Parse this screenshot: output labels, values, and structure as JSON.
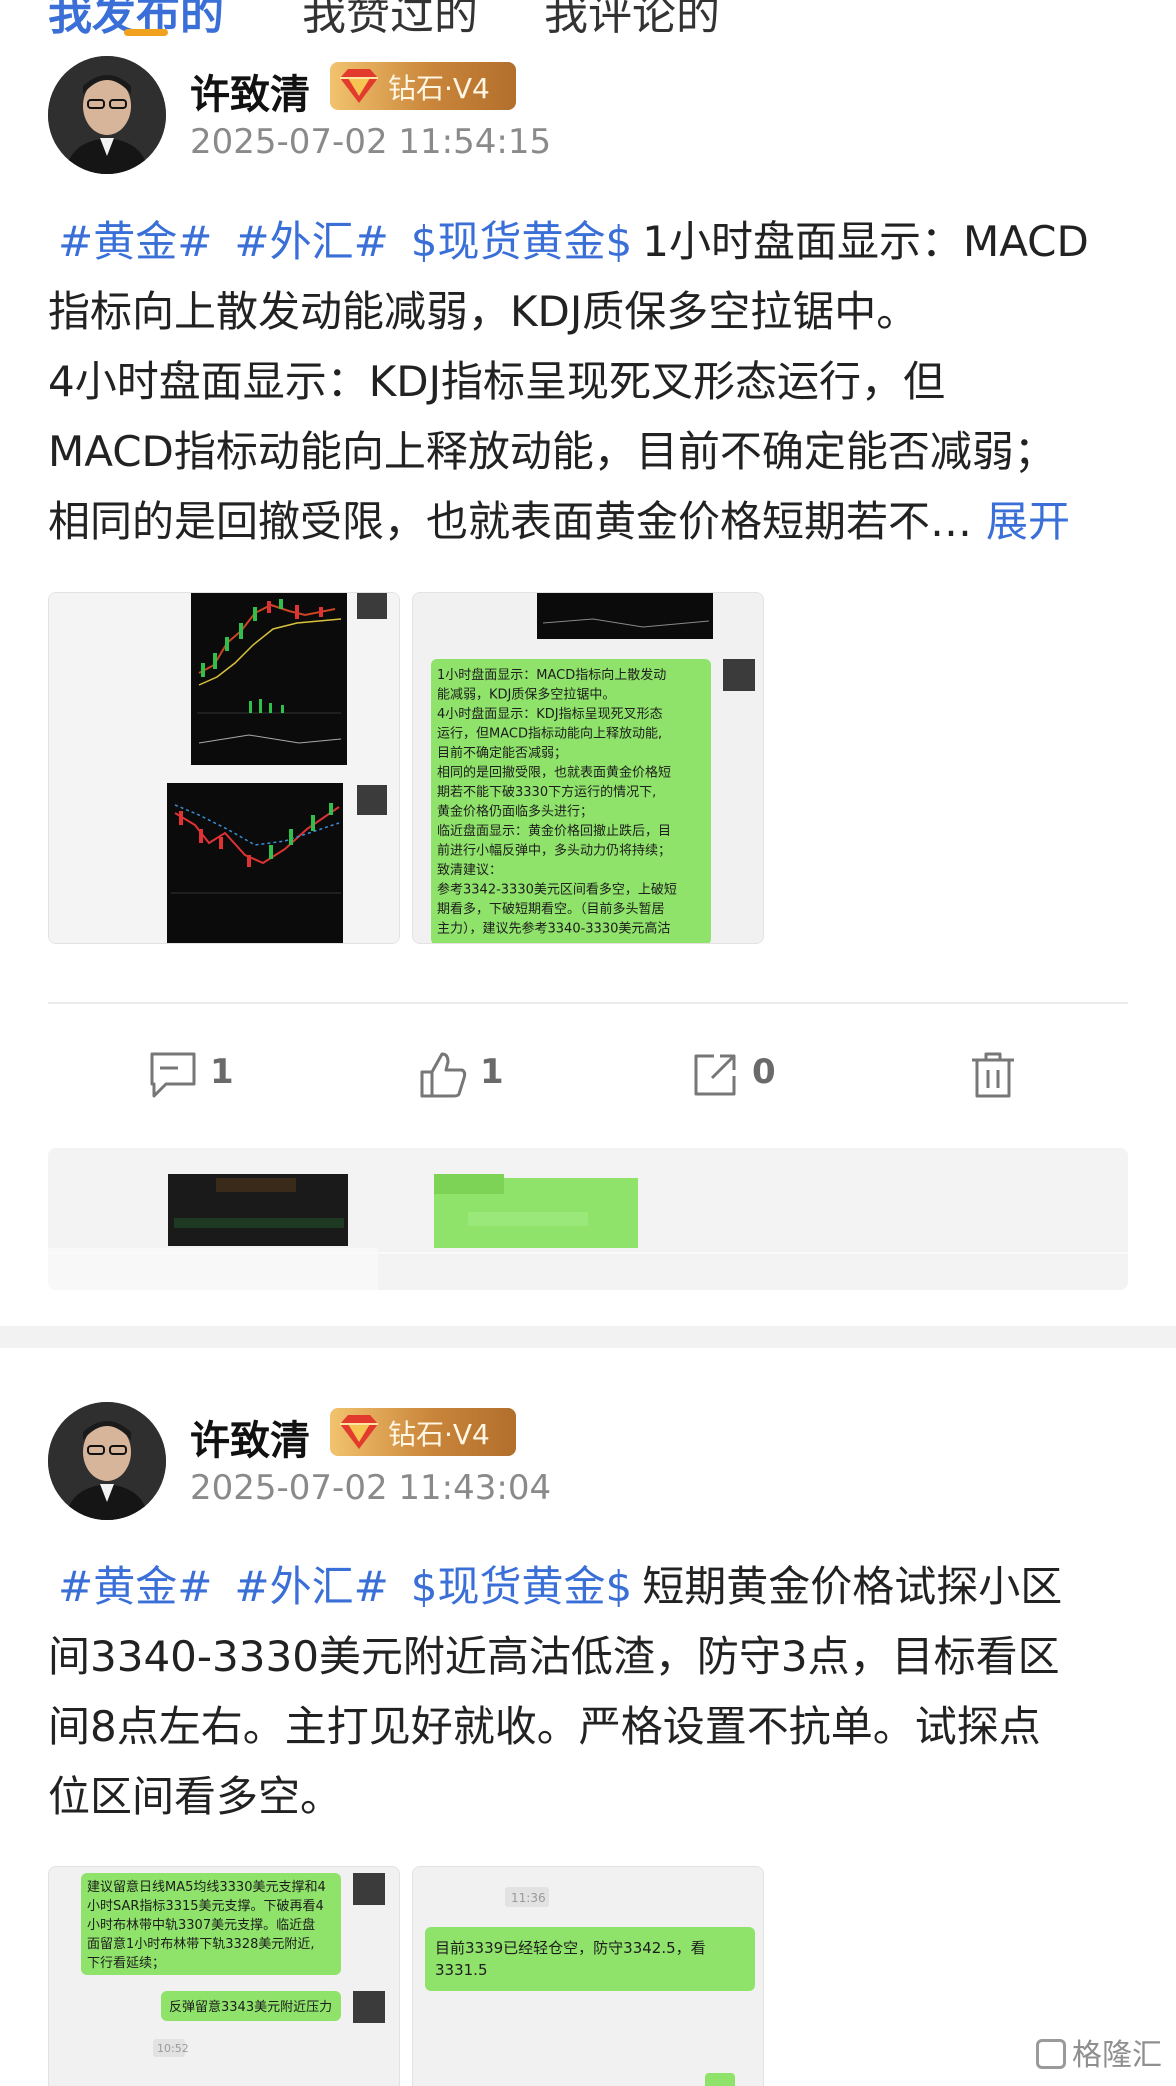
{
  "tabs": [
    "我发布的",
    "我赞过的",
    "我评论的"
  ],
  "posts": [
    {
      "author": "许致清",
      "badge": "钻石·V4",
      "time": "2025-07-02 11:54:15",
      "tags": [
        "#黄金#",
        "#外汇#",
        "$现货黄金$"
      ],
      "lines": [
        "1小时盘面显示：MACD",
        "指标向上散发动能减弱，KDJ质保多空拉锯中。",
        "4小时盘面显示：KDJ指标呈现死叉形态运行，但",
        "MACD指标动能向上释放动能，目前不确定能否减弱；",
        "相同的是回撤受限，也就表面黄金价格短期若不…"
      ],
      "expand": "展开",
      "chat_text": [
        "1小时盘面显示：MACD指标向上散发动",
        "能减弱，KDJ质保多空拉锯中。",
        "4小时盘面显示：KDJ指标呈现死叉形态",
        "运行，但MACD指标动能向上释放动能,",
        "目前不确定能否减弱；",
        "相同的是回撤受限，也就表面黄金价格短",
        "期若不能下破3330下方运行的情况下,",
        "黄金价格仍面临多头进行；",
        "临近盘面显示：黄金价格回撤止跌后，目",
        "前进行小幅反弹中，多头动力仍将持续；",
        "致清建议：",
        "参考3342-3330美元区间看多空，上破短",
        "期看多，下破短期看空。（目前多头暂居",
        "主力），建议先参考3340-3330美元高沽"
      ],
      "comments": "1",
      "likes": "1",
      "shares": "0"
    },
    {
      "author": "许致清",
      "badge": "钻石·V4",
      "time": "2025-07-02 11:43:04",
      "tags": [
        "#黄金#",
        "#外汇#",
        "$现货黄金$"
      ],
      "lines": [
        "短期黄金价格试探小区",
        "间3340-3330美元附近高沽低渣，防守3点，目标看区",
        "间8点左右。主打见好就收。严格设置不抗单。试探点",
        "位区间看多空。"
      ],
      "chat1_text": [
        "建议留意日线MA5均线3330美元支撑和4",
        "小时SAR指标3315美元支撑。下破再看4",
        "小时布林带中轨3307美元支撑。临近盘",
        "面留意1小时布林带下轨3328美元附近,",
        "下行看延续；"
      ],
      "chat1_reply": "反弹留意3343美元附近压力",
      "chat1_time": "10:52",
      "chat2_time": "11:36",
      "chat2_text": [
        "目前3339已经轻仓空，防守3342.5，看",
        "3331.5"
      ]
    }
  ],
  "watermark": "格隆汇",
  "colors": {
    "link": "#3a6fd8",
    "tab_indicator": "#f0a11e",
    "chat_bubble": "#8fe26a"
  }
}
